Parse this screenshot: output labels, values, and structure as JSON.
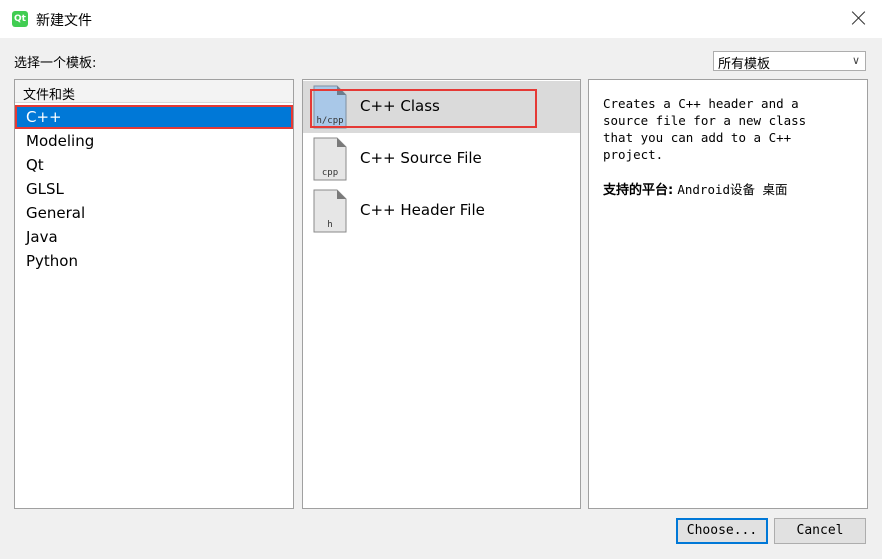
{
  "window": {
    "title": "新建文件",
    "app_icon_text": "Qt"
  },
  "choose_template_label": "选择一个模板:",
  "filter": {
    "selected": "所有模板"
  },
  "categories": {
    "header": "文件和类",
    "items": [
      "C++",
      "Modeling",
      "Qt",
      "GLSL",
      "General",
      "Java",
      "Python"
    ],
    "selected_index": 0
  },
  "templates": [
    {
      "name": "C++ Class",
      "icon_label": "h/cpp",
      "icon": "class-file-icon",
      "selected": true
    },
    {
      "name": "C++ Source File",
      "icon_label": "cpp",
      "icon": "source-file-icon",
      "selected": false
    },
    {
      "name": "C++ Header File",
      "icon_label": "h",
      "icon": "header-file-icon",
      "selected": false
    }
  ],
  "description": {
    "lines": [
      "Creates a C++ header and a",
      "source file for a new class",
      "that you can add to a C++",
      "project."
    ],
    "platform_label": "支持的平台:",
    "platforms": "Android设备 桌面"
  },
  "buttons": {
    "choose": "Choose...",
    "cancel": "Cancel"
  },
  "colors": {
    "selection": "#0078d7",
    "highlight_box": "#e53935",
    "qt_green": "#41cd52"
  }
}
